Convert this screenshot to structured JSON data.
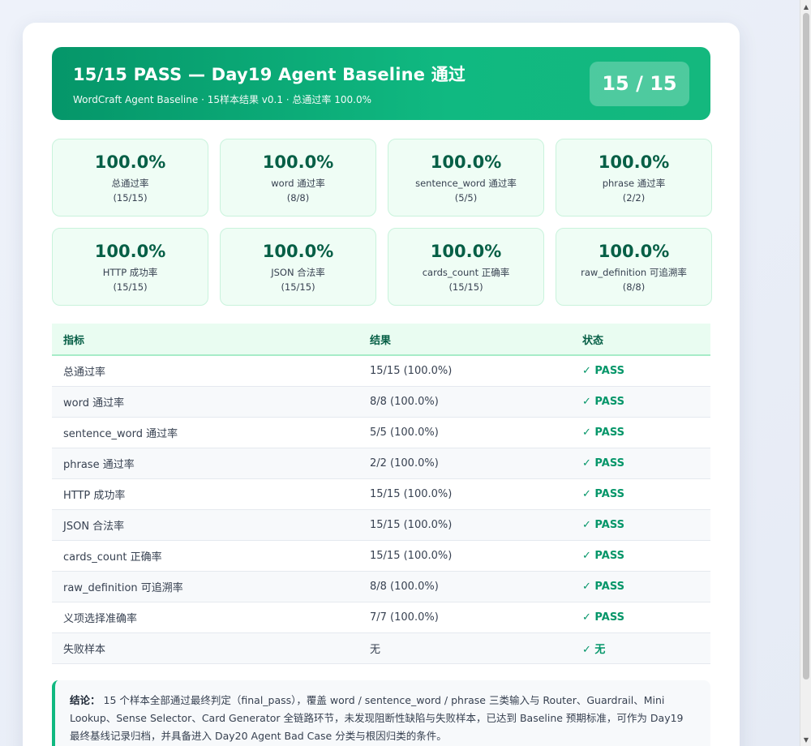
{
  "banner": {
    "title": "15/15 PASS — Day19 Agent Baseline 通过",
    "subtitle": "WordCraft Agent Baseline · 15样本结果 v0.1 · 总通过率 100.0%",
    "score": "15 / 15"
  },
  "metrics": [
    {
      "value": "100.0%",
      "label": "总通过率",
      "count": "(15/15)"
    },
    {
      "value": "100.0%",
      "label": "word 通过率",
      "count": "(8/8)"
    },
    {
      "value": "100.0%",
      "label": "sentence_word 通过率",
      "count": "(5/5)"
    },
    {
      "value": "100.0%",
      "label": "phrase 通过率",
      "count": "(2/2)"
    },
    {
      "value": "100.0%",
      "label": "HTTP 成功率",
      "count": "(15/15)"
    },
    {
      "value": "100.0%",
      "label": "JSON 合法率",
      "count": "(15/15)"
    },
    {
      "value": "100.0%",
      "label": "cards_count 正确率",
      "count": "(15/15)"
    },
    {
      "value": "100.0%",
      "label": "raw_definition 可追溯率",
      "count": "(8/8)"
    }
  ],
  "table": {
    "headers": [
      "指标",
      "结果",
      "状态"
    ],
    "rows": [
      [
        "总通过率",
        "15/15 (100.0%)",
        "✓ PASS"
      ],
      [
        "word 通过率",
        "8/8 (100.0%)",
        "✓ PASS"
      ],
      [
        "sentence_word 通过率",
        "5/5 (100.0%)",
        "✓ PASS"
      ],
      [
        "phrase 通过率",
        "2/2 (100.0%)",
        "✓ PASS"
      ],
      [
        "HTTP 成功率",
        "15/15 (100.0%)",
        "✓ PASS"
      ],
      [
        "JSON 合法率",
        "15/15 (100.0%)",
        "✓ PASS"
      ],
      [
        "cards_count 正确率",
        "15/15 (100.0%)",
        "✓ PASS"
      ],
      [
        "raw_definition 可追溯率",
        "8/8 (100.0%)",
        "✓ PASS"
      ],
      [
        "义项选择准确率",
        "7/7 (100.0%)",
        "✓ PASS"
      ],
      [
        "失败样本",
        "无",
        "✓ 无"
      ]
    ]
  },
  "conclusion": {
    "label": "结论：",
    "text": "15 个样本全部通过最终判定（final_pass），覆盖 word / sentence_word / phrase 三类输入与 Router、Guardrail、Mini Lookup、Sense Selector、Card Generator 全链路环节，未发现阻断性缺陷与失败样本，已达到 Baseline 预期标准，可作为 Day19 最终基线记录归档，并具备进入 Day20 Agent Bad Case 分类与根因归类的条件。"
  },
  "scrollbar": {
    "up_icon": "▲",
    "down_icon": "▼"
  },
  "colors": {
    "accent": "#10b981",
    "accent_dark": "#059669",
    "metric_bg": "#effdf5"
  }
}
